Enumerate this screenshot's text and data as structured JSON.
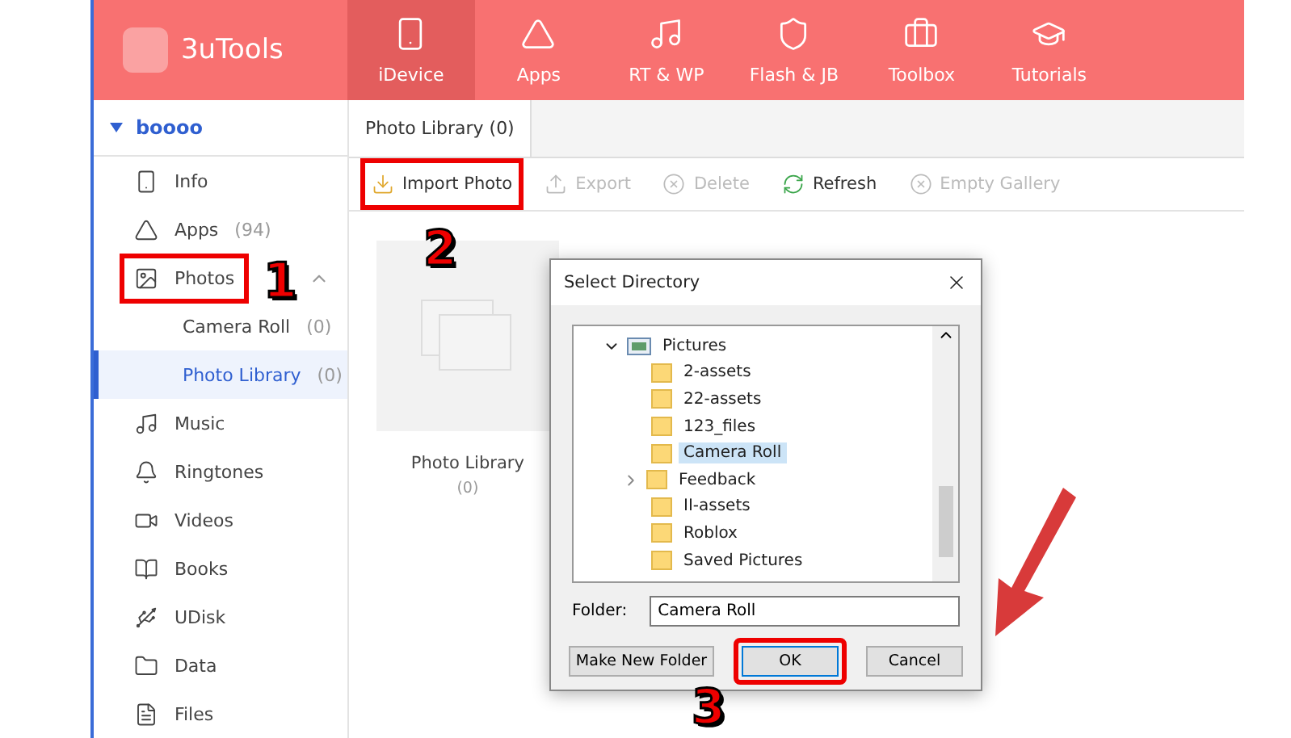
{
  "app": {
    "logo": "3uTools",
    "nav": [
      {
        "label": "iDevice",
        "selected": true
      },
      {
        "label": "Apps",
        "selected": false
      },
      {
        "label": "RT & WP",
        "selected": false
      },
      {
        "label": "Flash & JB",
        "selected": false
      },
      {
        "label": "Toolbox",
        "selected": false
      },
      {
        "label": "Tutorials",
        "selected": false
      }
    ]
  },
  "sidebar": {
    "device": "boooo",
    "items": [
      {
        "label": "Info",
        "selected": false,
        "highlighted": false
      },
      {
        "label": "Apps",
        "count": "(94)",
        "selected": false,
        "highlighted": false
      },
      {
        "label": "Photos",
        "selected": false,
        "highlighted": true,
        "expanded": true,
        "children": [
          {
            "label": "Camera Roll",
            "count": "(0)",
            "selected": false
          },
          {
            "label": "Photo Library",
            "count": "(0)",
            "selected": true
          }
        ]
      },
      {
        "label": "Music",
        "selected": false,
        "highlighted": false
      },
      {
        "label": "Ringtones",
        "selected": false,
        "highlighted": false
      },
      {
        "label": "Videos",
        "selected": false,
        "highlighted": false
      },
      {
        "label": "Books",
        "selected": false,
        "highlighted": false
      },
      {
        "label": "UDisk",
        "selected": false,
        "highlighted": false
      },
      {
        "label": "Data",
        "selected": false,
        "highlighted": false
      },
      {
        "label": "Files",
        "selected": false,
        "highlighted": false
      }
    ]
  },
  "tabs": [
    {
      "label": "Photo Library (0)",
      "selected": true
    }
  ],
  "toolbar": [
    {
      "label": "Import Photo",
      "disabled": false,
      "highlighted": true
    },
    {
      "label": "Export",
      "disabled": true,
      "highlighted": false
    },
    {
      "label": "Delete",
      "disabled": true,
      "highlighted": false
    },
    {
      "label": "Refresh",
      "disabled": false,
      "highlighted": false
    },
    {
      "label": "Empty Gallery",
      "disabled": true,
      "highlighted": false
    }
  ],
  "albums": [
    {
      "name": "Photo Library",
      "count": "(0)"
    }
  ],
  "dialog": {
    "title": "Select Directory",
    "tree": {
      "label": "Pictures",
      "expanded": true,
      "children": [
        {
          "label": "2-assets",
          "selected": false,
          "expandable": false
        },
        {
          "label": "22-assets",
          "selected": false,
          "expandable": false
        },
        {
          "label": "123_files",
          "selected": false,
          "expandable": false
        },
        {
          "label": "Camera Roll",
          "selected": true,
          "expandable": false
        },
        {
          "label": "Feedback",
          "selected": false,
          "expandable": true
        },
        {
          "label": "II-assets",
          "selected": false,
          "expandable": false
        },
        {
          "label": "Roblox",
          "selected": false,
          "expandable": false
        },
        {
          "label": "Saved Pictures",
          "selected": false,
          "expandable": false
        }
      ]
    },
    "folder_label": "Folder:",
    "folder_value": "Camera Roll",
    "buttons": [
      {
        "label": "Make New Folder",
        "highlighted": false,
        "default": false
      },
      {
        "label": "OK",
        "highlighted": true,
        "default": true
      },
      {
        "label": "Cancel",
        "highlighted": false,
        "default": false
      }
    ]
  },
  "annotations": [
    {
      "label": "1"
    },
    {
      "label": "2"
    },
    {
      "label": "3"
    }
  ]
}
